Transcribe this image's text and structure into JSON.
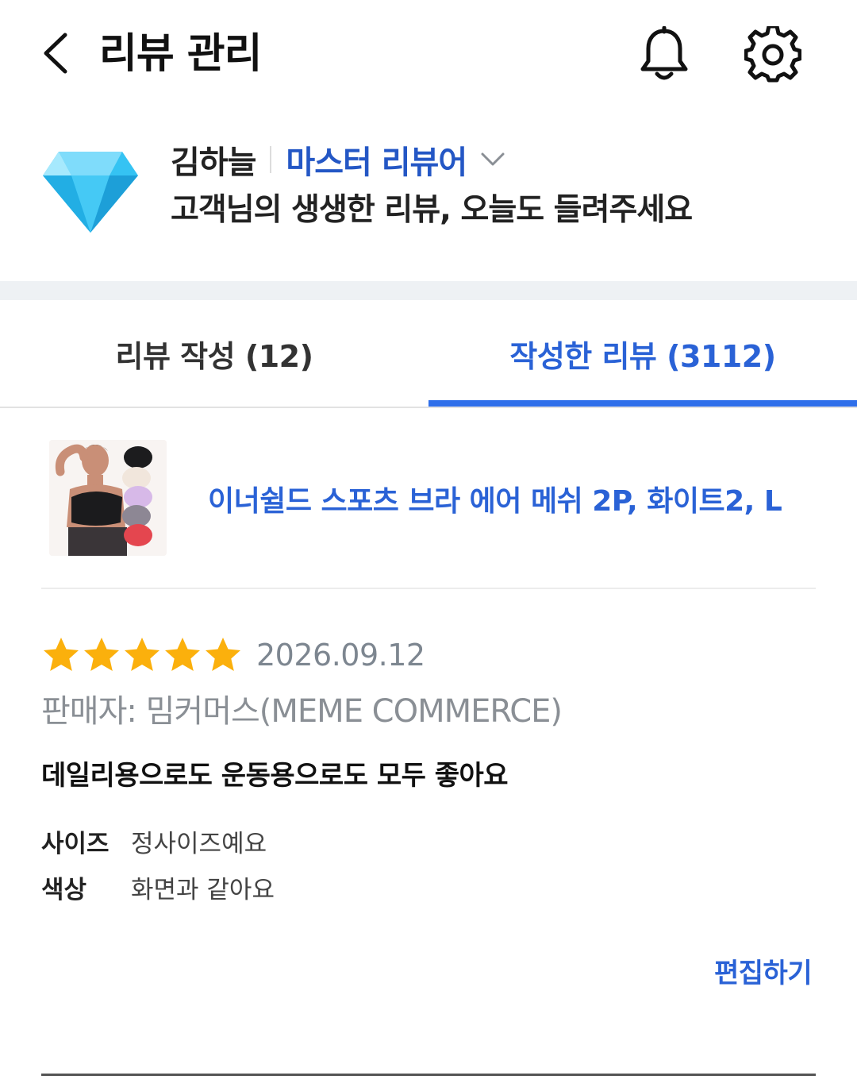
{
  "header": {
    "title": "리뷰 관리",
    "icons": {
      "back": "chevron-left-icon",
      "notifications": "bell-icon",
      "settings": "gear-icon"
    }
  },
  "profile": {
    "name": "김하늘",
    "grade": "마스터 리뷰어",
    "tagline": "고객님의 생생한 리뷰, 오늘도 들려주세요",
    "badge_icon": "diamond-icon"
  },
  "tabs": [
    {
      "label": "리뷰 작성 (12)",
      "active": false
    },
    {
      "label": "작성한 리뷰 (3112)",
      "active": true
    }
  ],
  "review": {
    "product_name": "이너쉴드 스포츠 브라 에어 메쉬 2P, 화이트2, L",
    "rating": 5,
    "rating_max": 5,
    "date": "2026.09.12",
    "seller": "판매자: 밈커머스(MEME COMMERCE)",
    "text": "데일리용으로도 운동용으로도 모두 좋아요",
    "attributes": [
      {
        "label": "사이즈",
        "value": "정사이즈예요"
      },
      {
        "label": "색상",
        "value": "화면과 같아요"
      }
    ],
    "edit_label": "편집하기"
  },
  "colors": {
    "accent": "#2f6fea",
    "link_text": "#2a62d6",
    "star": "#fbb00c",
    "band": "#eef1f4"
  }
}
